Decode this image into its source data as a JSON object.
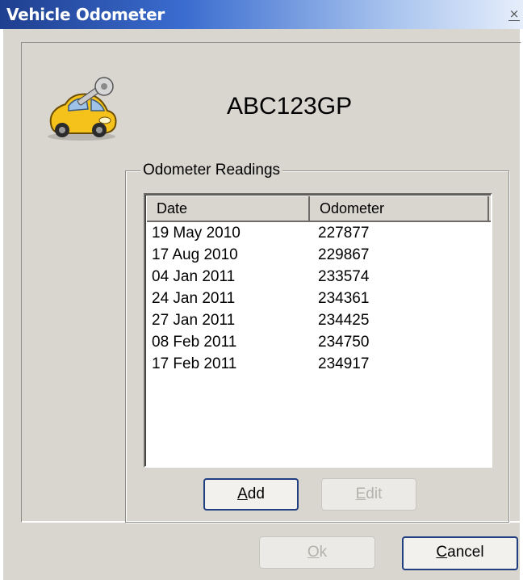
{
  "window": {
    "title": "Vehicle Odometer",
    "close_glyph": "×"
  },
  "vehicle": {
    "registration": "ABC123GP",
    "icon": "car-key-icon"
  },
  "readings": {
    "group_label": "Odometer Readings",
    "columns": [
      "Date",
      "Odometer"
    ],
    "rows": [
      {
        "date": "19 May 2010",
        "odometer": "227877"
      },
      {
        "date": "17 Aug 2010",
        "odometer": "229867"
      },
      {
        "date": "04 Jan 2011",
        "odometer": "233574"
      },
      {
        "date": "24 Jan 2011",
        "odometer": "234361"
      },
      {
        "date": "27 Jan 2011",
        "odometer": "234425"
      },
      {
        "date": "08 Feb 2011",
        "odometer": "234750"
      },
      {
        "date": "17 Feb 2011",
        "odometer": "234917"
      }
    ]
  },
  "buttons": {
    "add": {
      "mnemonic": "A",
      "rest": "dd"
    },
    "edit": {
      "mnemonic": "E",
      "rest": "dit"
    },
    "ok": {
      "mnemonic": "O",
      "rest": "k"
    },
    "cancel": {
      "mnemonic": "C",
      "rest": "ancel"
    }
  }
}
